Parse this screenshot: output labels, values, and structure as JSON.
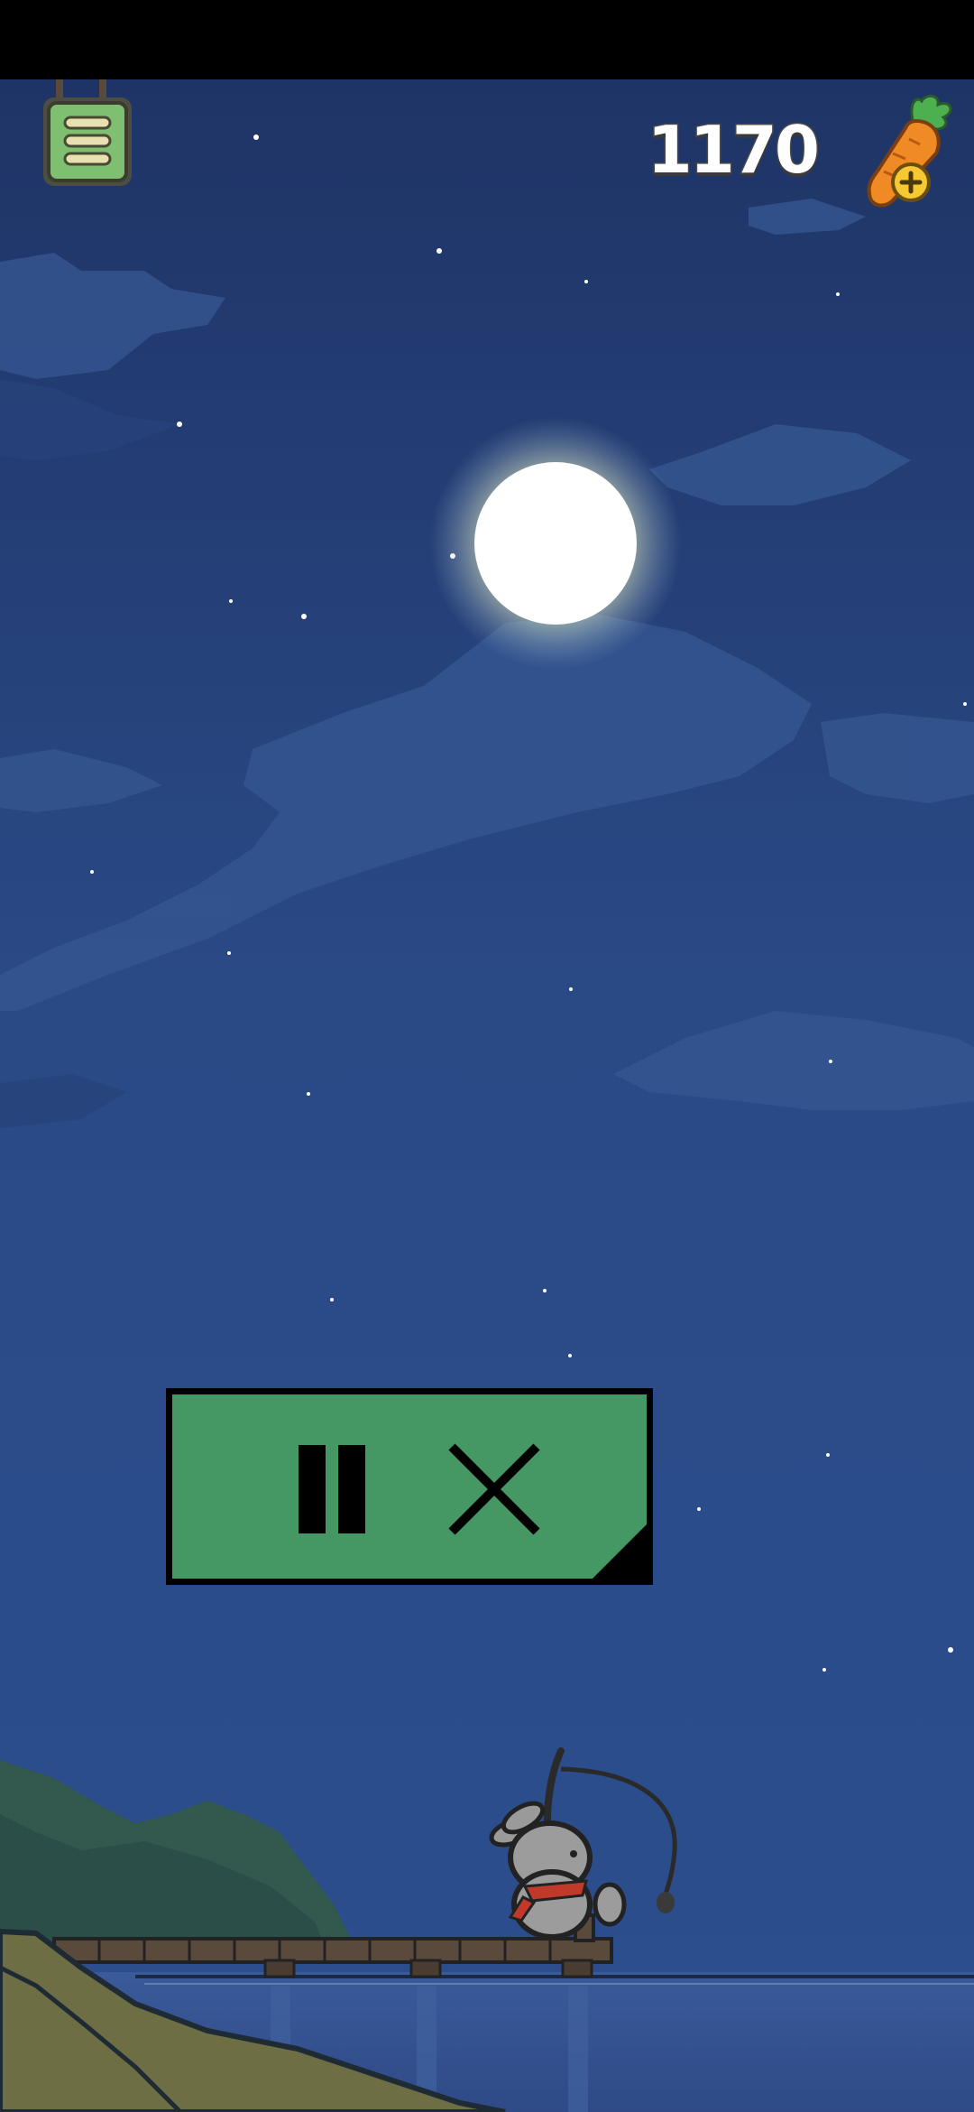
{
  "hud": {
    "carrot_count": "1170",
    "menu_icon": "menu-icon",
    "carrot_icon": "carrot-plus-icon"
  },
  "controls": {
    "pause_icon": "pause-icon",
    "close_icon": "close-icon"
  },
  "colors": {
    "sky_top": "#1f3466",
    "sky_bottom": "#2c4e8e",
    "panel_green": "#459863",
    "moon": "#ffffff"
  }
}
